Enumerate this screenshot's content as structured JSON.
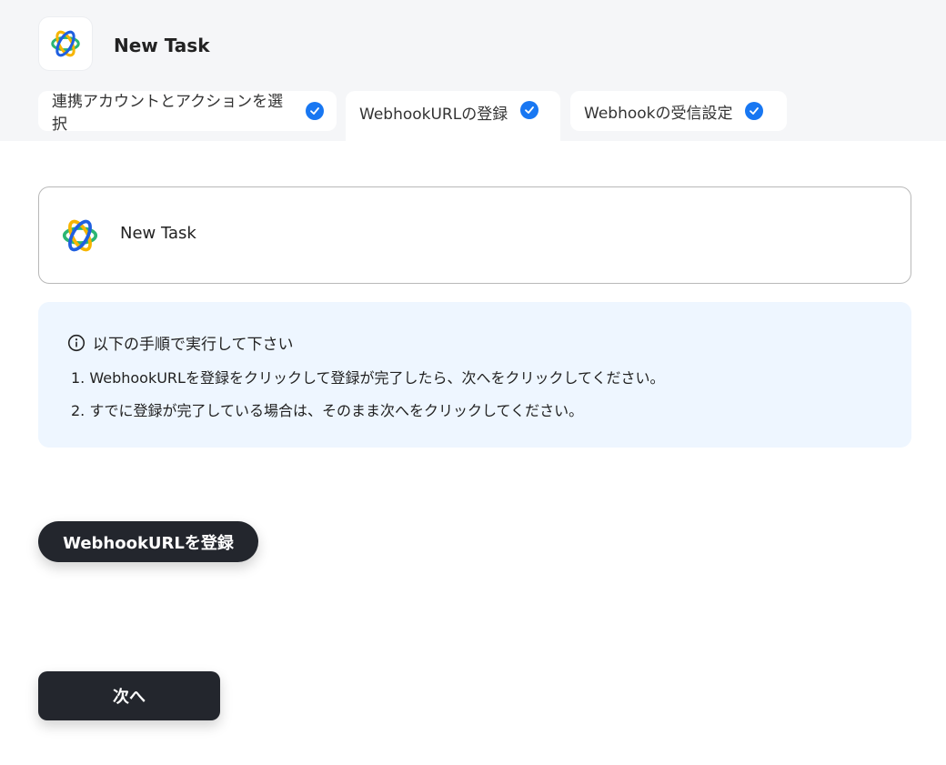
{
  "header": {
    "app_icon": "ring-logo-icon",
    "title": "New Task"
  },
  "tabs": [
    {
      "label": "連携アカウントとアクションを選択",
      "status_icon": "check-circle-icon",
      "active": false
    },
    {
      "label": "WebhookURLの登録",
      "status_icon": "check-circle-icon",
      "active": true
    },
    {
      "label": "Webhookの受信設定",
      "status_icon": "check-circle-icon",
      "active": false
    }
  ],
  "trigger": {
    "icon": "ring-logo-icon",
    "name": "New Task"
  },
  "instructions": {
    "icon": "info-icon",
    "title": "以下の手順で実行して下さい",
    "steps": [
      "1. WebhookURLを登録をクリックして登録が完了したら、次へをクリックしてください。",
      "2. すでに登録が完了している場合は、そのまま次へをクリックしてください。"
    ]
  },
  "buttons": {
    "register_label": "WebhookURLを登録",
    "next_label": "次へ"
  },
  "colors": {
    "accent": "#1877f2",
    "button_dark": "#23262d",
    "info_bg": "#eef6ff",
    "header_bg": "#f5f6f8"
  }
}
